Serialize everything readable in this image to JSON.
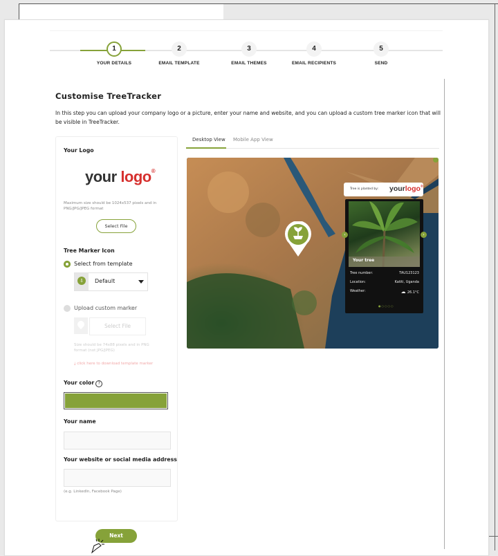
{
  "steps": [
    {
      "number": "1",
      "label": "YOUR DETAILS"
    },
    {
      "number": "2",
      "label": "EMAIL TEMPLATE"
    },
    {
      "number": "3",
      "label": "EMAIL THEMES"
    },
    {
      "number": "4",
      "label": "EMAIL RECIPIENTS"
    },
    {
      "number": "5",
      "label": "SEND"
    }
  ],
  "active_step": 1,
  "page": {
    "title": "Customise TreeTracker",
    "intro": "In this step you can upload your company logo or a picture, enter your name and website, and you can upload a custom tree marker icon that will be visible in TreeTracker."
  },
  "logo_section": {
    "label": "Your Logo",
    "logo_word1": "your",
    "logo_word2": "logo",
    "logo_reg": "®",
    "hint": "Maximum size should be 1024x537 pixels and in PNG/JPG/JPEG format",
    "select_button": "Select File"
  },
  "marker_section": {
    "label": "Tree Marker Icon",
    "option_template": "Select from template",
    "template_value": "Default",
    "option_custom": "Upload custom marker",
    "upload_button": "Select File",
    "custom_hint": "Size should be 74x88 pixels and in PNG format (not JPG/JPEG)",
    "download_link": "click here to download template marker"
  },
  "color_section": {
    "label": "Your color",
    "info": "?",
    "value": "#86a239"
  },
  "name_section": {
    "label": "Your name",
    "value": ""
  },
  "website_section": {
    "label": "Your website or social media address",
    "value": "",
    "hint": "(e.g. LinkedIn, Facebook Page)"
  },
  "tabs": [
    {
      "label": "Desktop View",
      "active": true
    },
    {
      "label": "Mobile App View",
      "active": false
    }
  ],
  "popup": {
    "planted_by": "Tree is planted by:",
    "logo_word1": "your",
    "logo_word2": "logo",
    "logo_reg": "®",
    "heading": "Your tree",
    "rows": [
      {
        "label": "Tree number:",
        "value": "TAU123123"
      },
      {
        "label": "Location:",
        "value": "Katiti, Uganda"
      },
      {
        "label": "Weather:",
        "value": "26.1°C"
      }
    ]
  },
  "next_button": "Next",
  "colors": {
    "accent": "#86a239",
    "logo_red": "#d6302e"
  }
}
